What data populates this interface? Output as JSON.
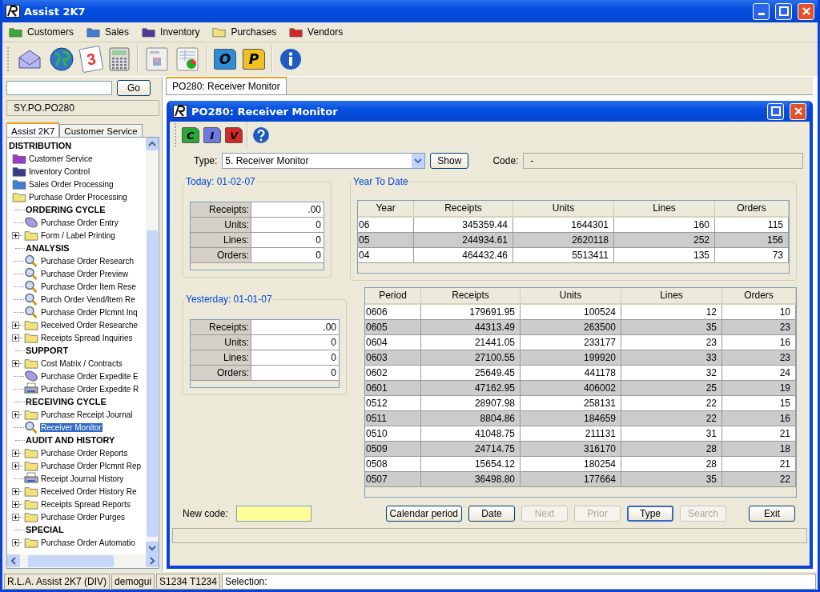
{
  "window": {
    "title": "Assist 2K7"
  },
  "menu": [
    {
      "label": "Customers",
      "color": "#3aa832"
    },
    {
      "label": "Sales",
      "color": "#3d7fd6"
    },
    {
      "label": "Inventory",
      "color": "#4a3a9a"
    },
    {
      "label": "Purchases",
      "color": "#f2e27a"
    },
    {
      "label": "Vendors",
      "color": "#d42828"
    }
  ],
  "toolbar": [
    {
      "kind": "envelope"
    },
    {
      "kind": "globe"
    },
    {
      "kind": "calendar",
      "letter": "3"
    },
    {
      "kind": "calculator"
    },
    {
      "kind": "sep"
    },
    {
      "kind": "card"
    },
    {
      "kind": "chart"
    },
    {
      "kind": "sep"
    },
    {
      "kind": "letter-folder",
      "letter": "O",
      "color": "#2a8fd8"
    },
    {
      "kind": "letter-folder",
      "letter": "P",
      "color": "#f0c020"
    },
    {
      "kind": "sep"
    },
    {
      "kind": "info"
    }
  ],
  "sidebar": {
    "go_button": "Go",
    "path": "SY.PO.PO280",
    "tabs": [
      {
        "label": "Assist 2K7",
        "selected": true
      },
      {
        "label": "Customer Service",
        "selected": false
      }
    ],
    "tree": [
      {
        "kind": "category",
        "label": "DISTRIBUTION",
        "children": [
          {
            "kind": "folder",
            "color": "#9a3ac8",
            "label": "Customer Service",
            "selected": false
          },
          {
            "kind": "folder",
            "color": "#3a3a8a",
            "label": "Inventory Control",
            "selected": false
          },
          {
            "kind": "folder",
            "color": "#3d7fd6",
            "label": "Sales Order Processing",
            "selected": false
          },
          {
            "kind": "folder",
            "color": "#f2e27a",
            "label": "Purchase Order Processing",
            "selected": false,
            "children": [
              {
                "kind": "heading",
                "label": "ORDERING CYCLE",
                "children": [
                  {
                    "kind": "entry",
                    "label": "Purchase Order Entry",
                    "expandable": false,
                    "selected": false
                  },
                  {
                    "kind": "folder",
                    "color": "#f2e27a",
                    "label": "Form / Label Printing",
                    "expandable": true,
                    "selected": false
                  }
                ]
              },
              {
                "kind": "heading",
                "label": "ANALYSIS",
                "children": [
                  {
                    "kind": "inquiry",
                    "label": "Purchase Order Research",
                    "expandable": false,
                    "selected": false
                  },
                  {
                    "kind": "inquiry",
                    "label": "Purchase Order Preview",
                    "expandable": false,
                    "selected": false
                  },
                  {
                    "kind": "inquiry",
                    "label": "Purchase Order Item Rese",
                    "expandable": false,
                    "selected": false
                  },
                  {
                    "kind": "inquiry",
                    "label": "Purch Order Vend/Item Re",
                    "expandable": false,
                    "selected": false
                  },
                  {
                    "kind": "inquiry",
                    "label": "Purchase Order Plcmnt Inq",
                    "expandable": false,
                    "selected": false
                  },
                  {
                    "kind": "folder",
                    "color": "#f2e27a",
                    "label": "Received Order Researche",
                    "expandable": true,
                    "selected": false
                  },
                  {
                    "kind": "folder",
                    "color": "#f2e27a",
                    "label": "Receipts Spread Inquiries",
                    "expandable": true,
                    "selected": false
                  }
                ]
              },
              {
                "kind": "heading",
                "label": "SUPPORT",
                "children": [
                  {
                    "kind": "folder",
                    "color": "#f2e27a",
                    "label": "Cost Matrix / Contracts",
                    "expandable": true,
                    "selected": false
                  },
                  {
                    "kind": "entry",
                    "label": "Purchase Order Expedite E",
                    "expandable": false,
                    "selected": false
                  },
                  {
                    "kind": "report",
                    "label": "Purchase Order Expedite R",
                    "expandable": false,
                    "selected": false
                  }
                ]
              },
              {
                "kind": "heading",
                "label": "RECEIVING CYCLE",
                "children": [
                  {
                    "kind": "folder",
                    "color": "#f2e27a",
                    "label": "Purchase Receipt Journal",
                    "expandable": true,
                    "selected": false
                  },
                  {
                    "kind": "inquiry",
                    "label": "Receiver Monitor",
                    "expandable": false,
                    "selected": true
                  }
                ]
              },
              {
                "kind": "heading",
                "label": "AUDIT AND HISTORY",
                "children": [
                  {
                    "kind": "folder",
                    "color": "#f2e27a",
                    "label": "Purchase Order Reports",
                    "expandable": true,
                    "selected": false
                  },
                  {
                    "kind": "folder",
                    "color": "#f2e27a",
                    "label": "Purchase Order Plcmnt Rep",
                    "expandable": true,
                    "selected": false
                  },
                  {
                    "kind": "report",
                    "label": "Receipt Journal History",
                    "expandable": false,
                    "selected": false
                  },
                  {
                    "kind": "folder",
                    "color": "#f2e27a",
                    "label": "Received Order History Re",
                    "expandable": true,
                    "selected": false
                  },
                  {
                    "kind": "folder",
                    "color": "#f2e27a",
                    "label": "Receipts Spread Reports",
                    "expandable": true,
                    "selected": false
                  },
                  {
                    "kind": "folder",
                    "color": "#f2e27a",
                    "label": "Purchase Order Purges",
                    "expandable": true,
                    "selected": false
                  }
                ]
              },
              {
                "kind": "heading",
                "label": "SPECIAL",
                "children": [
                  {
                    "kind": "folder",
                    "color": "#f2e27a",
                    "label": "Purchase Order Automatio",
                    "expandable": true,
                    "selected": false
                  }
                ]
              }
            ]
          }
        ]
      }
    ]
  },
  "doc_tabs": [
    {
      "label": "PO280: Receiver Monitor",
      "selected": true
    }
  ],
  "dialog": {
    "title": "PO280: Receiver Monitor",
    "toolbar": [
      {
        "kind": "letter-folder",
        "letter": "C",
        "color": "#2aa83a"
      },
      {
        "kind": "letter-folder",
        "letter": "I",
        "color": "#6a7ae0"
      },
      {
        "kind": "letter-folder",
        "letter": "V",
        "color": "#d42828"
      },
      {
        "kind": "sep"
      },
      {
        "kind": "help"
      }
    ],
    "type_label": "Type:",
    "type_value": "5. Receiver Monitor",
    "show_button": "Show",
    "code_label": "Code:",
    "code_value": "-",
    "today": {
      "title": "Today: 01-02-07",
      "rows": [
        {
          "label": "Receipts:",
          "value": ".00"
        },
        {
          "label": "Units:",
          "value": "0"
        },
        {
          "label": "Lines:",
          "value": "0"
        },
        {
          "label": "Orders:",
          "value": "0"
        }
      ]
    },
    "yesterday": {
      "title": "Yesterday: 01-01-07",
      "rows": [
        {
          "label": "Receipts:",
          "value": ".00"
        },
        {
          "label": "Units:",
          "value": "0"
        },
        {
          "label": "Lines:",
          "value": "0"
        },
        {
          "label": "Orders:",
          "value": "0"
        }
      ]
    },
    "ytd": {
      "title": "Year To Date",
      "columns": [
        "Year",
        "Receipts",
        "Units",
        "Lines",
        "Orders"
      ],
      "rows": [
        [
          "06",
          "345359.44",
          "1644301",
          "160",
          "115"
        ],
        [
          "05",
          "244934.61",
          "2620118",
          "252",
          "156"
        ],
        [
          "04",
          "464432.46",
          "5513411",
          "135",
          "73"
        ]
      ]
    },
    "periods": {
      "columns": [
        "Period",
        "Receipts",
        "Units",
        "Lines",
        "Orders"
      ],
      "rows": [
        [
          "0606",
          "179691.95",
          "100524",
          "12",
          "10"
        ],
        [
          "0605",
          "44313.49",
          "263500",
          "35",
          "23"
        ],
        [
          "0604",
          "21441.05",
          "233177",
          "23",
          "16"
        ],
        [
          "0603",
          "27100.55",
          "199920",
          "33",
          "23"
        ],
        [
          "0602",
          "25649.45",
          "441178",
          "32",
          "24"
        ],
        [
          "0601",
          "47162.95",
          "406002",
          "25",
          "19"
        ],
        [
          "0512",
          "28907.98",
          "258131",
          "22",
          "15"
        ],
        [
          "0511",
          "8804.86",
          "184659",
          "22",
          "16"
        ],
        [
          "0510",
          "41048.75",
          "211131",
          "31",
          "21"
        ],
        [
          "0509",
          "24714.75",
          "316170",
          "28",
          "18"
        ],
        [
          "0508",
          "15654.12",
          "180254",
          "28",
          "21"
        ],
        [
          "0507",
          "36498.80",
          "177664",
          "35",
          "22"
        ]
      ]
    },
    "new_code_label": "New code:",
    "buttons": [
      {
        "label": "Calendar period",
        "disabled": false,
        "focused": false
      },
      {
        "label": "Date",
        "disabled": false,
        "focused": false
      },
      {
        "label": "Next",
        "disabled": true,
        "focused": false
      },
      {
        "label": "Prior",
        "disabled": true,
        "focused": false
      },
      {
        "label": "Type",
        "disabled": false,
        "focused": true
      },
      {
        "label": "Search",
        "disabled": true,
        "focused": false
      },
      {
        "label": "Exit",
        "disabled": false,
        "focused": false
      }
    ]
  },
  "status_bar": [
    "R.L.A. Assist 2K7 (DIV)",
    "demogui",
    "S1234 T1234",
    "Selection:"
  ]
}
